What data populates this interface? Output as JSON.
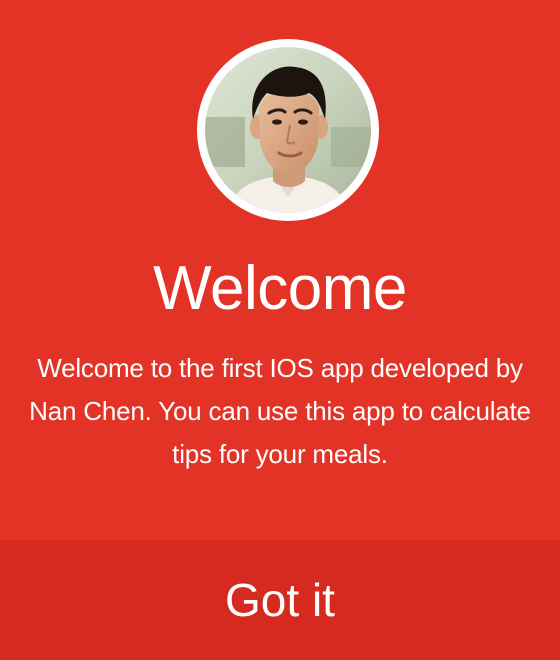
{
  "welcome": {
    "avatar_icon": "profile-photo",
    "title": "Welcome",
    "message": "Welcome to the first IOS app developed by Nan Chen. You can use this app to calculate tips for your meals.",
    "button_label": "Got it"
  },
  "colors": {
    "background": "#e33326",
    "button_background": "#d42a1f",
    "text": "#ffffff",
    "avatar_border": "#ffffff"
  }
}
